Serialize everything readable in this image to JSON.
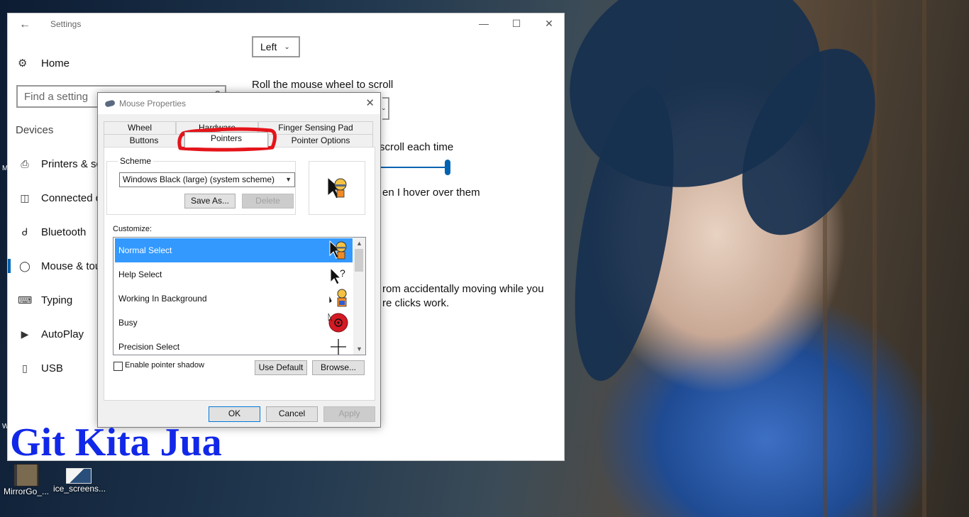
{
  "settings": {
    "title": "Settings",
    "home_label": "Home",
    "search_placeholder": "Find a setting",
    "section": "Devices",
    "nav_items": [
      {
        "label": "Printers & scanners",
        "icon": "printer-icon"
      },
      {
        "label": "Connected devices",
        "icon": "connected-devices-icon"
      },
      {
        "label": "Bluetooth",
        "icon": "bluetooth-icon"
      },
      {
        "label": "Mouse & touchpad",
        "icon": "mouse-icon"
      },
      {
        "label": "Typing",
        "icon": "keyboard-icon"
      },
      {
        "label": "AutoPlay",
        "icon": "autoplay-icon"
      },
      {
        "label": "USB",
        "icon": "usb-icon"
      }
    ],
    "primary_button_value": "Left",
    "roll_wheel_label": "Roll the mouse wheel to scroll",
    "lines_label_partial": "scroll each time",
    "hover_label_partial": "en I hover over them",
    "touchpad_text_line1": "rom accidentally moving while you",
    "touchpad_text_line2": "re clicks work."
  },
  "dialog": {
    "title": "Mouse Properties",
    "tabs": {
      "wheel": "Wheel",
      "hardware": "Hardware",
      "finger_sensing_pad": "Finger Sensing Pad",
      "buttons": "Buttons",
      "pointers": "Pointers",
      "pointer_options": "Pointer Options"
    },
    "scheme_group_label": "Scheme",
    "scheme_value": "Windows Black (large) (system scheme)",
    "save_as_label": "Save As...",
    "delete_label": "Delete",
    "customize_label": "Customize:",
    "cursor_items": [
      {
        "label": "Normal Select",
        "selected": true
      },
      {
        "label": "Help Select",
        "selected": false
      },
      {
        "label": "Working In Background",
        "selected": false
      },
      {
        "label": "Busy",
        "selected": false
      },
      {
        "label": "Precision Select",
        "selected": false
      }
    ],
    "shadow_label": "Enable pointer shadow",
    "shadow_checked": false,
    "use_default_label": "Use Default",
    "browse_label": "Browse...",
    "ok_label": "OK",
    "cancel_label": "Cancel",
    "apply_label": "Apply"
  },
  "watermark": "Git Kita Jua",
  "desktop_icons": [
    {
      "label": "MirrorGo_..."
    },
    {
      "label": "ice_screens..."
    }
  ],
  "colors": {
    "accent": "#0063b1",
    "selection": "#3399ff",
    "annotation": "#e5141b",
    "watermark": "#1228e8"
  }
}
